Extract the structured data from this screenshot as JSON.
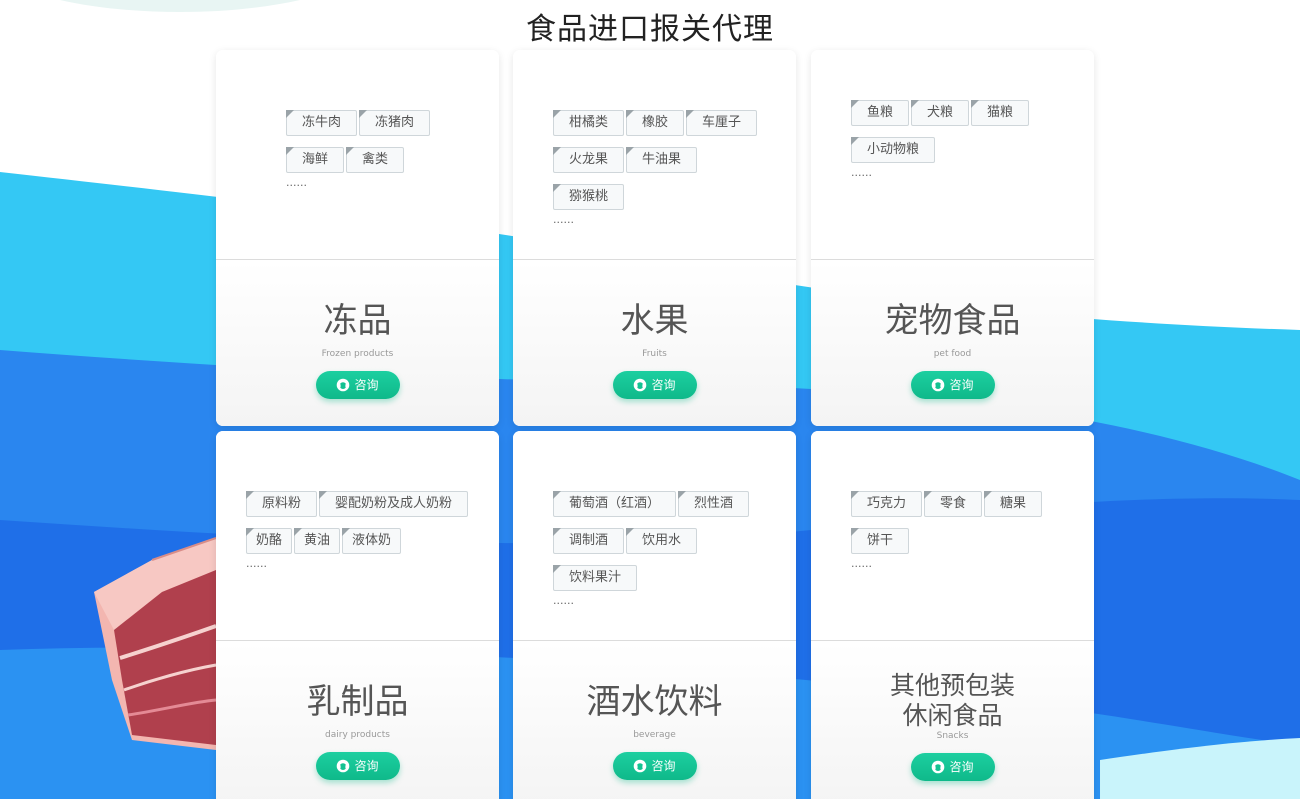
{
  "page_title": "食品进口报关代理",
  "consult_label": "咨询",
  "more_marker": "......",
  "colors": {
    "accent": "#14c292",
    "wave_light": "#3ad0f5",
    "wave_dark": "#2a7cf0"
  },
  "categories": [
    {
      "title": "冻品",
      "subtitle": "Frozen products",
      "tags": [
        "冻牛肉",
        "冻猪肉",
        "海鲜",
        "禽类"
      ]
    },
    {
      "title": "水果",
      "subtitle": "Fruits",
      "tags": [
        "柑橘类",
        "橡胶",
        "车厘子",
        "火龙果",
        "牛油果",
        "猕猴桃"
      ]
    },
    {
      "title": "宠物食品",
      "subtitle": "pet food",
      "tags": [
        "鱼粮",
        "犬粮",
        "猫粮",
        "小动物粮"
      ]
    },
    {
      "title": "乳制品",
      "subtitle": "dairy products",
      "tags": [
        "原料粉",
        "婴配奶粉及成人奶粉",
        "奶酪",
        "黄油",
        "液体奶"
      ]
    },
    {
      "title": "酒水饮料",
      "subtitle": "beverage",
      "tags": [
        "葡萄酒（红酒）",
        "烈性酒",
        "调制酒",
        "饮用水",
        "饮料果汁"
      ]
    },
    {
      "title_line1": "其他预包装",
      "title_line2": "休闲食品",
      "subtitle": "Snacks",
      "tags": [
        "巧克力",
        "零食",
        "糖果",
        "饼干"
      ]
    }
  ]
}
